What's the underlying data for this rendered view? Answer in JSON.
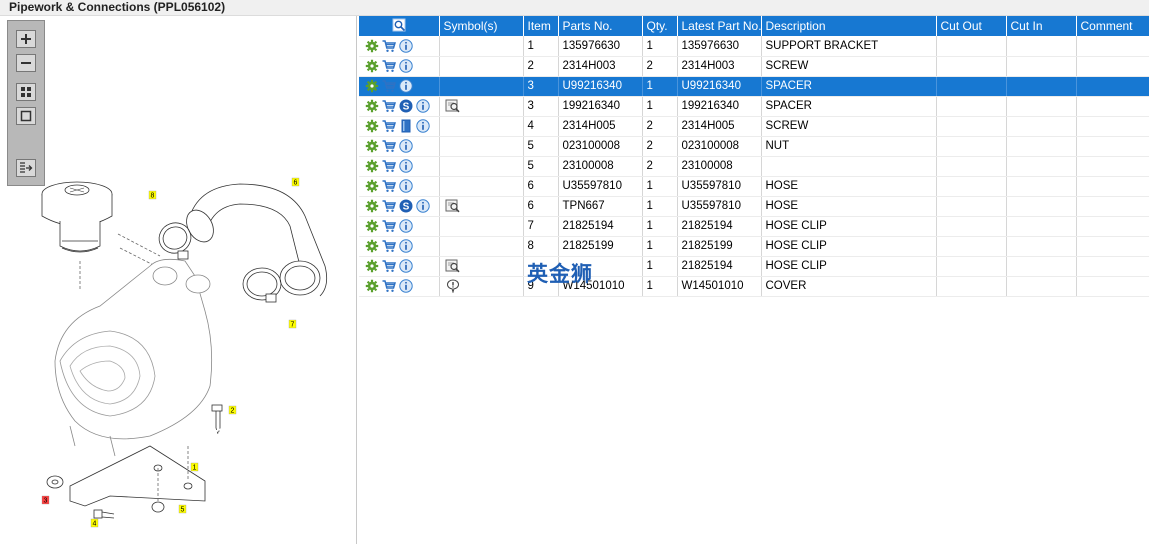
{
  "title": "Pipework & Connections (PPL056102)",
  "toolbar": {
    "zoom_in": "zoom-in",
    "zoom_out": "zoom-out",
    "fit": "fit-view",
    "actual": "actual-size",
    "toggle": "toggle-panel"
  },
  "colors": {
    "header": "#1778d2",
    "selected_row": "#1778d2",
    "gear_icon": "#5aa02c",
    "cart_icon": "#2f72c4",
    "info_icon": "#3a82d0",
    "callout_yellow": "#ffff00",
    "callout_red": "#ff4040"
  },
  "diagram": {
    "callouts": [
      "1",
      "2",
      "3",
      "4",
      "5",
      "6",
      "7",
      "8"
    ]
  },
  "table": {
    "columns": [
      "",
      "Symbol(s)",
      "Item",
      "Parts No.",
      "Qty.",
      "Latest Part No.",
      "Description",
      "Cut Out",
      "Cut In",
      "Comment"
    ],
    "rows": [
      {
        "icons": [
          "gear-icon",
          "cart-icon",
          "info-icon"
        ],
        "symbols": [],
        "item": "1",
        "part": "135976630",
        "qty": "1",
        "latest": "135976630",
        "desc": "SUPPORT BRACKET",
        "cut_out": "",
        "cut_in": "",
        "comment": ""
      },
      {
        "icons": [
          "gear-icon",
          "cart-icon",
          "info-icon"
        ],
        "symbols": [],
        "item": "2",
        "part": "2314H003",
        "qty": "2",
        "latest": "2314H003",
        "desc": "SCREW",
        "cut_out": "",
        "cut_in": "",
        "comment": ""
      },
      {
        "icons": [
          "gear-icon",
          "cart-icon",
          "info-icon"
        ],
        "symbols": [],
        "item": "3",
        "part": "U99216340",
        "qty": "1",
        "latest": "U99216340",
        "desc": "SPACER",
        "cut_out": "",
        "cut_in": "",
        "comment": "",
        "selected": true
      },
      {
        "icons": [
          "gear-icon",
          "cart-icon",
          "s-badge-icon",
          "info-icon"
        ],
        "symbols": [
          "book-search-icon"
        ],
        "item": "3",
        "part": "199216340",
        "qty": "1",
        "latest": "199216340",
        "desc": "SPACER",
        "cut_out": "",
        "cut_in": "",
        "comment": ""
      },
      {
        "icons": [
          "gear-icon",
          "cart-icon",
          "book-icon",
          "info-icon"
        ],
        "symbols": [],
        "item": "4",
        "part": "2314H005",
        "qty": "2",
        "latest": "2314H005",
        "desc": "SCREW",
        "cut_out": "",
        "cut_in": "",
        "comment": ""
      },
      {
        "icons": [
          "gear-icon",
          "cart-icon",
          "info-icon"
        ],
        "symbols": [],
        "item": "5",
        "part": "023100008",
        "qty": "2",
        "latest": "023100008",
        "desc": "NUT",
        "cut_out": "",
        "cut_in": "",
        "comment": ""
      },
      {
        "icons": [
          "gear-icon",
          "cart-icon",
          "info-icon"
        ],
        "symbols": [],
        "item": "5",
        "part": "23100008",
        "qty": "2",
        "latest": "23100008",
        "desc": "",
        "cut_out": "",
        "cut_in": "",
        "comment": ""
      },
      {
        "icons": [
          "gear-icon",
          "cart-icon",
          "info-icon"
        ],
        "symbols": [],
        "item": "6",
        "part": "U35597810",
        "qty": "1",
        "latest": "U35597810",
        "desc": "HOSE",
        "cut_out": "",
        "cut_in": "",
        "comment": ""
      },
      {
        "icons": [
          "gear-icon",
          "cart-icon",
          "s-badge-icon",
          "info-icon"
        ],
        "symbols": [
          "book-search-icon"
        ],
        "item": "6",
        "part": "TPN667",
        "qty": "1",
        "latest": "U35597810",
        "desc": "HOSE",
        "cut_out": "",
        "cut_in": "",
        "comment": ""
      },
      {
        "icons": [
          "gear-icon",
          "cart-icon",
          "info-icon"
        ],
        "symbols": [],
        "item": "7",
        "part": "21825194",
        "qty": "1",
        "latest": "21825194",
        "desc": "HOSE CLIP",
        "cut_out": "",
        "cut_in": "",
        "comment": ""
      },
      {
        "icons": [
          "gear-icon",
          "cart-icon",
          "info-icon"
        ],
        "symbols": [],
        "item": "8",
        "part": "21825199",
        "qty": "1",
        "latest": "21825199",
        "desc": "HOSE CLIP",
        "cut_out": "",
        "cut_in": "",
        "comment": ""
      },
      {
        "icons": [
          "gear-icon",
          "cart-icon",
          "info-icon"
        ],
        "symbols": [
          "book-search-icon"
        ],
        "item": "",
        "part": "",
        "qty": "1",
        "latest": "21825194",
        "desc": "HOSE CLIP",
        "cut_out": "",
        "cut_in": "",
        "comment": ""
      },
      {
        "icons": [
          "gear-icon",
          "cart-icon",
          "info-icon"
        ],
        "symbols": [
          "note-pin-icon"
        ],
        "item": "9",
        "part": "W14501010",
        "qty": "1",
        "latest": "W14501010",
        "desc": "COVER",
        "cut_out": "",
        "cut_in": "",
        "comment": ""
      }
    ]
  },
  "watermark": "英金狮"
}
